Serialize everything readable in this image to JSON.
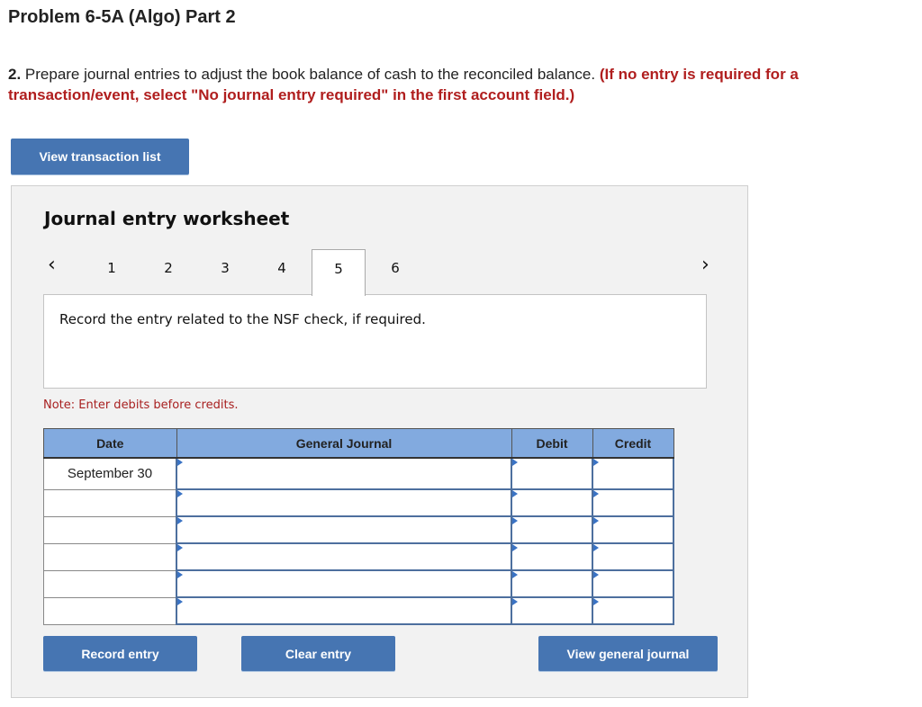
{
  "header": {
    "title": "Problem 6-5A (Algo) Part 2",
    "instruction_number": "2.",
    "instruction_text": " Prepare journal entries to adjust the book balance of cash to the reconciled balance. ",
    "instruction_note": "(If no entry is required for a transaction/event, select \"No journal entry required\" in the first account field.)"
  },
  "buttons": {
    "view_transaction_list": "View transaction list",
    "record_entry": "Record entry",
    "clear_entry": "Clear entry",
    "view_general_journal": "View general journal"
  },
  "worksheet": {
    "title": "Journal entry worksheet",
    "prev_icon": "‹",
    "next_icon": "›",
    "tabs": [
      "1",
      "2",
      "3",
      "4",
      "5",
      "6"
    ],
    "active_tab": "5",
    "description": "Record the entry related to the NSF check, if required.",
    "note": "Note: Enter debits before credits."
  },
  "journal": {
    "headers": {
      "date": "Date",
      "general_journal": "General Journal",
      "debit": "Debit",
      "credit": "Credit"
    },
    "rows": [
      {
        "date": "September 30",
        "account": "",
        "debit": "",
        "credit": ""
      },
      {
        "date": "",
        "account": "",
        "debit": "",
        "credit": ""
      },
      {
        "date": "",
        "account": "",
        "debit": "",
        "credit": ""
      },
      {
        "date": "",
        "account": "",
        "debit": "",
        "credit": ""
      },
      {
        "date": "",
        "account": "",
        "debit": "",
        "credit": ""
      },
      {
        "date": "",
        "account": "",
        "debit": "",
        "credit": ""
      }
    ]
  },
  "colors": {
    "accent_button": "#4675b2",
    "table_header": "#82aadf",
    "warning_red": "#b01e1e"
  }
}
